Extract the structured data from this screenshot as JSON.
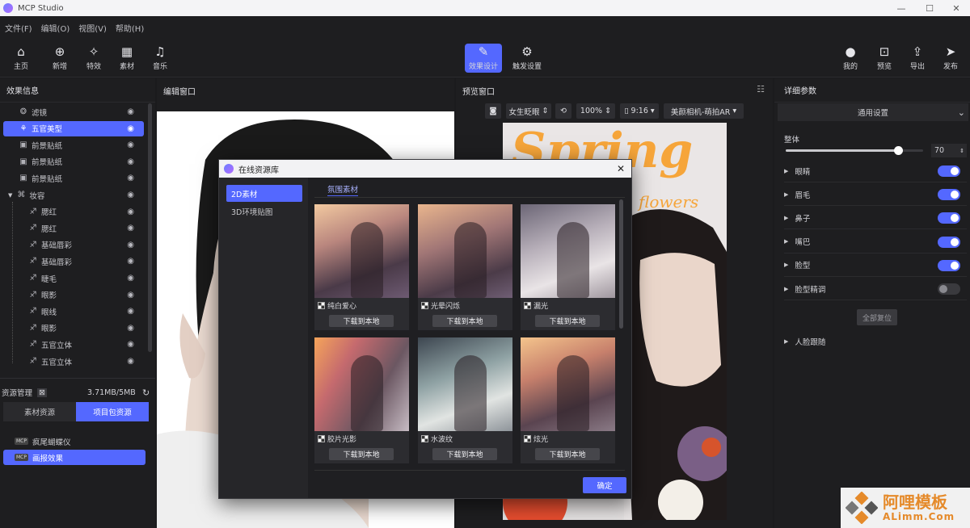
{
  "app": {
    "title": "MCP Studio"
  },
  "menu": [
    "文件(F)",
    "编辑(O)",
    "视图(V)",
    "帮助(H)"
  ],
  "toolbar": {
    "left": [
      {
        "label": "主页",
        "icon": "home-icon",
        "glyph": "⌂"
      },
      {
        "label": "新增",
        "icon": "add-circle-icon",
        "glyph": "⊕"
      },
      {
        "label": "特效",
        "icon": "sparkle-icon",
        "glyph": "✧"
      },
      {
        "label": "素材",
        "icon": "grid-icon",
        "glyph": "▦"
      },
      {
        "label": "音乐",
        "icon": "music-icon",
        "glyph": "♫"
      }
    ],
    "center": [
      {
        "label": "效果设计",
        "icon": "magic-wand-icon",
        "glyph": "✎",
        "active": true
      },
      {
        "label": "触发设置",
        "icon": "trigger-icon",
        "glyph": "⚙",
        "active": false
      }
    ],
    "right": [
      {
        "label": "我的",
        "icon": "user-dot-icon",
        "glyph": "●"
      },
      {
        "label": "预览",
        "icon": "preview-icon",
        "glyph": "⊡"
      },
      {
        "label": "导出",
        "icon": "export-icon",
        "glyph": "⇪"
      },
      {
        "label": "发布",
        "icon": "send-icon",
        "glyph": "➤"
      }
    ]
  },
  "left_panel": {
    "title": "效果信息",
    "layers": [
      {
        "label": "滤镜",
        "icon": "filter-icon",
        "glyph": "❂",
        "selected": false
      },
      {
        "label": "五官美型",
        "icon": "face-shape-icon",
        "glyph": "⚘",
        "selected": true
      },
      {
        "label": "前景贴纸",
        "icon": "sticker-icon",
        "glyph": "▣",
        "selected": false
      },
      {
        "label": "前景贴纸",
        "icon": "sticker-icon",
        "glyph": "▣",
        "selected": false
      },
      {
        "label": "前景贴纸",
        "icon": "sticker-icon",
        "glyph": "▣",
        "selected": false
      },
      {
        "label": "妆容",
        "icon": "makeup-group-icon",
        "glyph": "⌘",
        "selected": false
      },
      {
        "label": "腮红",
        "icon": "brush-icon",
        "glyph": "♐",
        "selected": false
      },
      {
        "label": "腮红",
        "icon": "brush-icon",
        "glyph": "♐",
        "selected": false
      },
      {
        "label": "基础唇彩",
        "icon": "brush-icon",
        "glyph": "♐",
        "selected": false
      },
      {
        "label": "基础唇彩",
        "icon": "brush-icon",
        "glyph": "♐",
        "selected": false
      },
      {
        "label": "睫毛",
        "icon": "brush-icon",
        "glyph": "♐",
        "selected": false
      },
      {
        "label": "眼影",
        "icon": "brush-icon",
        "glyph": "♐",
        "selected": false
      },
      {
        "label": "眼线",
        "icon": "brush-icon",
        "glyph": "♐",
        "selected": false
      },
      {
        "label": "眼影",
        "icon": "brush-icon",
        "glyph": "♐",
        "selected": false
      },
      {
        "label": "五官立体",
        "icon": "brush-icon",
        "glyph": "♐",
        "selected": false
      },
      {
        "label": "五官立体",
        "icon": "brush-icon",
        "glyph": "♐",
        "selected": false
      }
    ],
    "resources": {
      "title": "资源管理",
      "usage": "3.71MB/5MB",
      "tabs": [
        {
          "label": "素材资源",
          "active": false
        },
        {
          "label": "项目包资源",
          "active": true
        }
      ],
      "items": [
        {
          "label": "疯尾蝴蝶仪",
          "selected": false
        },
        {
          "label": "画报效果",
          "selected": true
        }
      ]
    }
  },
  "edit_window": {
    "title": "编辑窗口"
  },
  "preview_window": {
    "title": "预览窗口",
    "filter": "女生眨眼",
    "zoom": "100%",
    "ratio": "9:16",
    "camera": "美颜相机-萌拍AR",
    "poster_title": "Spring",
    "poster_sub": "flowers"
  },
  "right_panel": {
    "title": "详细参数",
    "section": "通用设置",
    "overall_label": "整体",
    "overall_value": "70",
    "overall_fraction": 0.82,
    "params": [
      {
        "label": "眼睛",
        "on": true
      },
      {
        "label": "眉毛",
        "on": true
      },
      {
        "label": "鼻子",
        "on": true
      },
      {
        "label": "嘴巴",
        "on": true
      },
      {
        "label": "脸型",
        "on": true
      },
      {
        "label": "脸型精调",
        "on": false
      }
    ],
    "reset_label": "全部复位",
    "face_tracking": "人脸跟随"
  },
  "dialog": {
    "title": "在线资源库",
    "categories": [
      {
        "label": "2D素材",
        "active": true
      },
      {
        "label": "3D环境贴图",
        "active": false
      }
    ],
    "tab": "氛围素材",
    "download_label": "下载到本地",
    "confirm_label": "确定",
    "items": [
      {
        "name": "纯白爱心"
      },
      {
        "name": "光晕闪烁"
      },
      {
        "name": "漏光"
      },
      {
        "name": "胶片光影"
      },
      {
        "name": "水波纹"
      },
      {
        "name": "炫光"
      }
    ]
  },
  "watermark": {
    "text": "阿哩模板",
    "sub": "ALimm.Com"
  },
  "colors": {
    "accent": "#5468ff",
    "bg": "#1e1e20"
  }
}
